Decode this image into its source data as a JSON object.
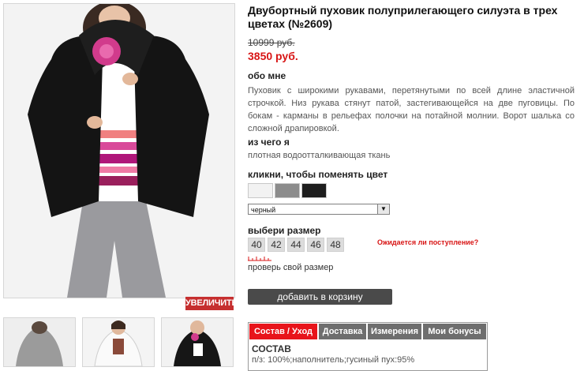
{
  "product": {
    "title": "Двубортный пуховик полуприлегающего силуэта в трех цветах (№2609)",
    "old_price": "10999 руб.",
    "new_price": "3850 руб."
  },
  "gallery": {
    "zoom_label": "УВЕЛИЧИТЬ"
  },
  "about": {
    "heading": "обо мне",
    "text": "Пуховик с широкими рукавами, перетянутыми по всей длине эластичной строчкой. Низ рукава стянут патой, застегивающейся на две пуговицы. По бокам - карманы в рельефах полочки на потайной молнии. Ворот шалька со сложной драпировкой."
  },
  "material": {
    "heading": "из чего я",
    "text": "плотная водоотталкивающая ткань"
  },
  "color": {
    "heading": "кликни, чтобы поменять цвет",
    "swatches": [
      "#f2f2f2",
      "#8c8c8c",
      "#1e1e1e"
    ],
    "selected": "черный"
  },
  "size": {
    "heading": "выбери размер",
    "options": [
      "40",
      "42",
      "44",
      "46",
      "48"
    ],
    "expected_link": "Ожидается ли поступление?",
    "check_label": "проверь свой размер"
  },
  "cart": {
    "button_label": "добавить в корзину"
  },
  "tabs": {
    "items": [
      "Состав / Уход",
      "Доставка",
      "Измерения",
      "Мои бонусы"
    ],
    "active_color": "#e8141b",
    "inactive_color": "#6e6e6e",
    "content_title": "СОСТАВ",
    "content_text": "п/з: 100%;наполнитель;гусиный пух:95%"
  }
}
